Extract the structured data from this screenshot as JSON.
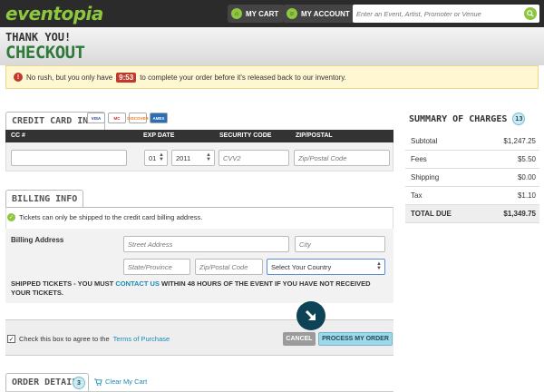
{
  "brand": {
    "logo": "eventopia"
  },
  "nav": {
    "cart": "MY CART",
    "account": "MY ACCOUNT",
    "search_placeholder": "Enter an Event, Artist, Promoter or Venue"
  },
  "header": {
    "thanks": "THANK YOU!",
    "title": "CHECKOUT"
  },
  "notice": {
    "before": "No rush, but you only have",
    "timer": "9:53",
    "after": "to complete your order before it's released back to our inventory."
  },
  "credit_card": {
    "tab": "CREDIT CARD INFO",
    "cards": [
      "VISA",
      "MC",
      "DISCOVER",
      "AMEX"
    ],
    "columns": [
      "CC #",
      "EXP DATE",
      "SECURITY CODE",
      "ZIP/POSTAL"
    ],
    "exp_month": "01",
    "exp_year": "2011",
    "cvv_placeholder": "CVV2",
    "zip_placeholder": "Zip/Postal Code"
  },
  "billing": {
    "tab": "BILLING INFO",
    "ship_note": "Tickets can only be shipped to the credit card billing address.",
    "label": "Billing Address",
    "street_placeholder": "Street Address",
    "city_placeholder": "City",
    "state_placeholder": "State/Province",
    "zip_placeholder": "Zip/Postal Code",
    "country": "Select Your Country",
    "shipped_pre": "SHIPPED TICKETS - YOU MUST",
    "shipped_link": "CONTACT US",
    "shipped_post": "WITHIN 48 HOURS OF THE EVENT IF YOU HAVE NOT RECEIVED YOUR TICKETS."
  },
  "agree": {
    "text": "Check this box to agree to the",
    "link": "Terms of Purchase",
    "cancel": "CANCEL",
    "process": "PROCESS MY ORDER"
  },
  "order_details": {
    "tab": "ORDER DETAILS",
    "count": "3",
    "clear": "Clear My Cart"
  },
  "summary": {
    "title": "SUMMARY OF CHARGES",
    "count": "13",
    "rows": [
      {
        "label": "Subtotal",
        "value": "$1,247.25"
      },
      {
        "label": "Fees",
        "value": "$5.50"
      },
      {
        "label": "Shipping",
        "value": "$0.00"
      },
      {
        "label": "Tax",
        "value": "$1.10"
      },
      {
        "label": "TOTAL DUE",
        "value": "$1,349.75"
      }
    ]
  },
  "colors": {
    "brand_green": "#8dc63f",
    "checkout_green": "#2f7a3a",
    "timer_red": "#c0392b",
    "link_blue": "#1a8ab5"
  }
}
